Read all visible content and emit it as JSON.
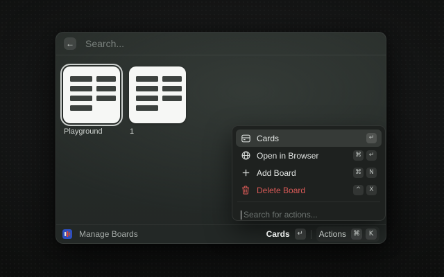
{
  "header": {
    "search_placeholder": "Search...",
    "back_icon": "back-arrow"
  },
  "boards": [
    {
      "label": "Playground",
      "selected": true
    },
    {
      "label": "1",
      "selected": false
    }
  ],
  "actions_menu": {
    "items": [
      {
        "label": "Cards",
        "icon": "card-icon",
        "keys": [
          "↵"
        ],
        "selected": true,
        "danger": false
      },
      {
        "label": "Open in Browser",
        "icon": "globe-icon",
        "keys": [
          "⌘",
          "↵"
        ],
        "selected": false,
        "danger": false
      },
      {
        "label": "Add Board",
        "icon": "plus-icon",
        "keys": [
          "⌘",
          "N"
        ],
        "selected": false,
        "danger": false
      },
      {
        "label": "Delete Board",
        "icon": "trash-icon",
        "keys": [
          "^",
          "X"
        ],
        "selected": false,
        "danger": true
      }
    ],
    "search_placeholder": "Search for actions..."
  },
  "footer": {
    "app_name": "Manage Boards",
    "primary_action": {
      "label": "Cards",
      "keys": [
        "↵"
      ]
    },
    "secondary_action": {
      "label": "Actions",
      "keys": [
        "⌘",
        "K"
      ]
    }
  },
  "colors": {
    "window_bg": "#272c29",
    "panel_bg": "#1e211f",
    "selected_row_bg": "#363a37",
    "danger_red": "#d95a57",
    "tile_white": "#f6f7f5",
    "tile_bar": "#3c413e",
    "app_icon_blue": "#2d4fc0"
  }
}
